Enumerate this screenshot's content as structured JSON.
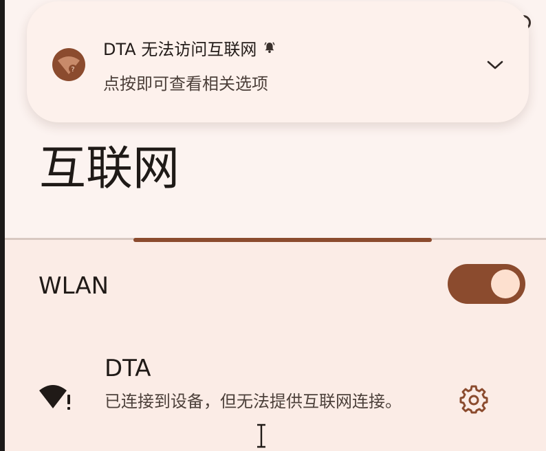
{
  "notification": {
    "title": "DTA 无法访问互联网",
    "body": "点按即可查看相关选项",
    "avatar_icon": "wifi-question-icon",
    "bell_icon": "bell-icon",
    "expand_icon": "chevron-down-icon"
  },
  "page": {
    "title": "互联网"
  },
  "wlan": {
    "label": "WLAN",
    "enabled": true
  },
  "network": {
    "name": "DTA",
    "status": "已连接到设备，但无法提供互联网连接。",
    "signal_icon": "wifi-warning-icon",
    "settings_icon": "gear-icon"
  },
  "colors": {
    "accent": "#8b4b2e",
    "toggle_thumb": "#fde0cf",
    "surface": "#fbece6",
    "header_surface": "#fcf3f0",
    "notification_surface": "#fdf1ec",
    "text_primary": "#201a17",
    "text_secondary": "#4c403a"
  }
}
